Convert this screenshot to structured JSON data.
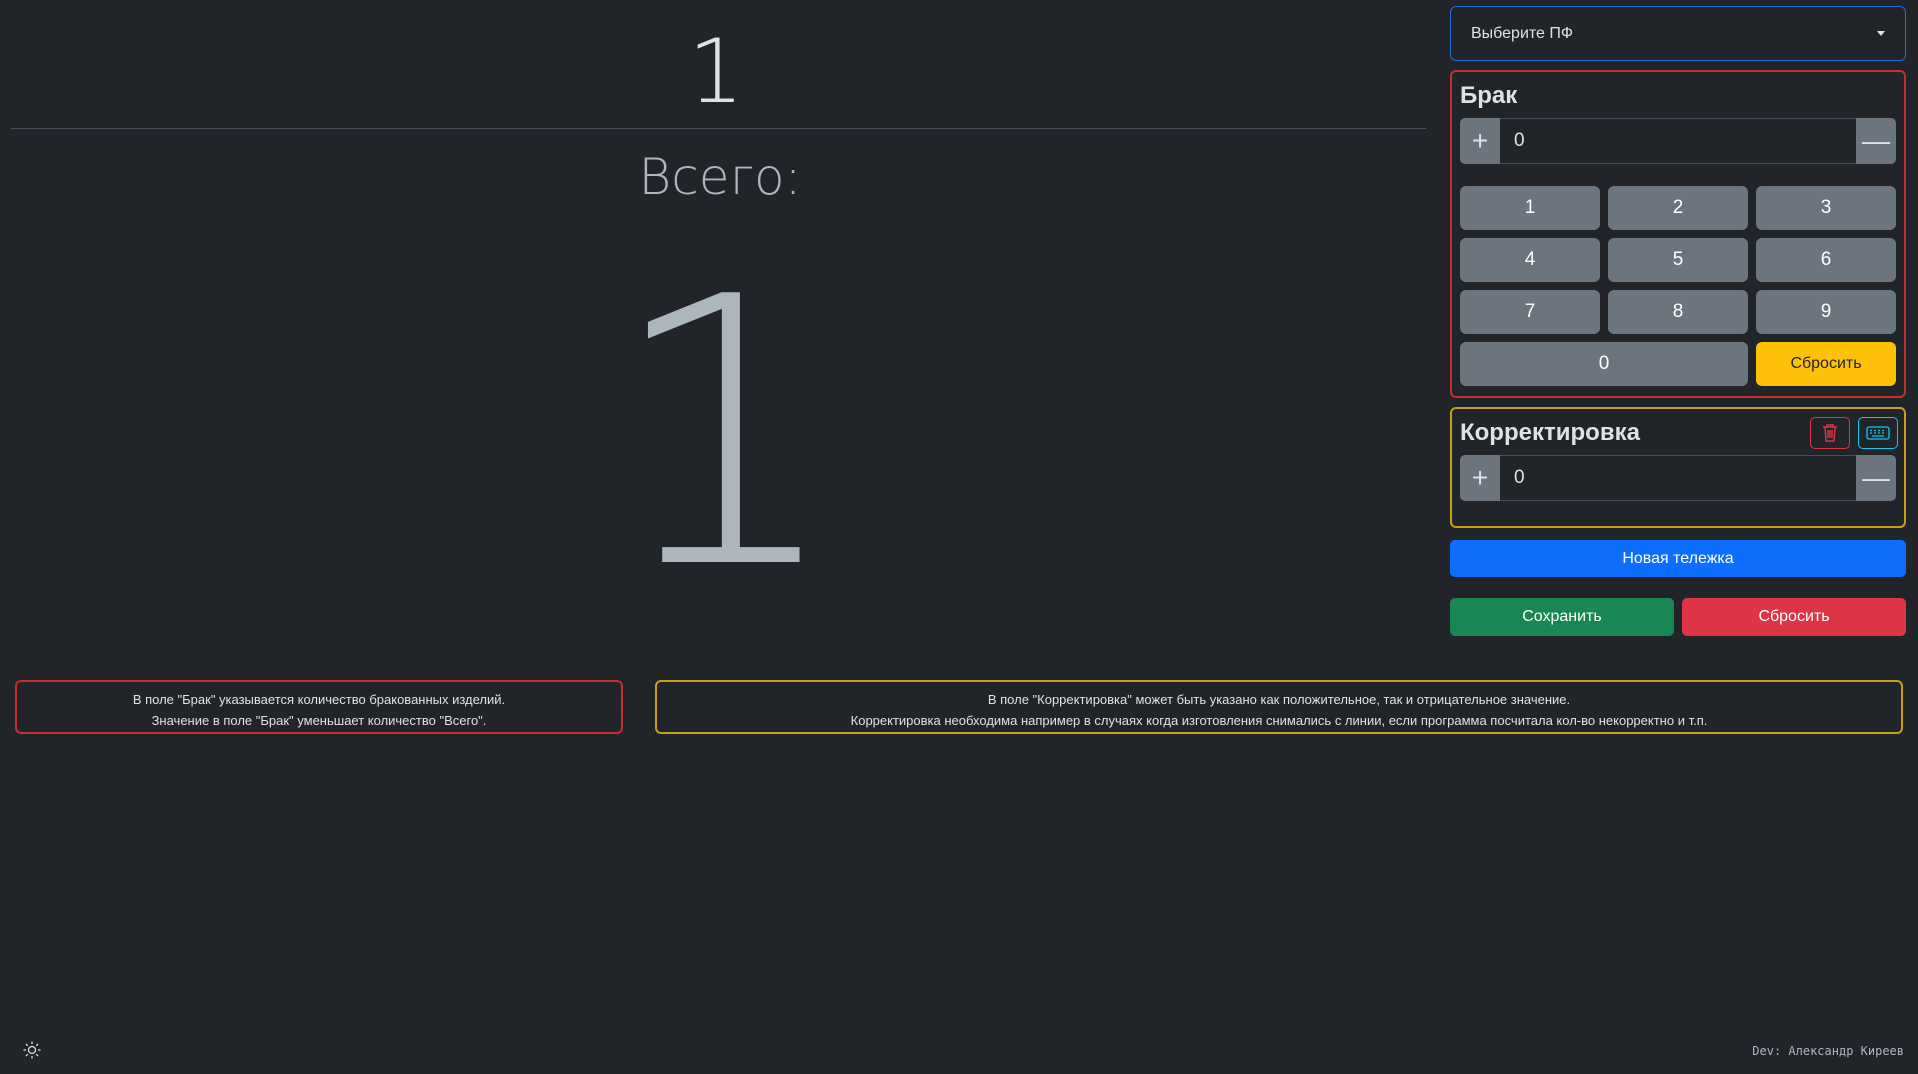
{
  "counter": {
    "top_value": "1",
    "total_label": "Всего:",
    "big_value": "1"
  },
  "select": {
    "label": "Выберите ПФ"
  },
  "brak": {
    "title": "Брак",
    "value": "0",
    "keys": [
      "1",
      "2",
      "3",
      "4",
      "5",
      "6",
      "7",
      "8",
      "9"
    ],
    "zero": "0",
    "reset_label": "Сбросить"
  },
  "korr": {
    "title": "Корректировка",
    "value": "0"
  },
  "buttons": {
    "new_cart": "Новая тележка",
    "save": "Сохранить",
    "reset": "Сбросить"
  },
  "info": {
    "brak_line1": "В поле \"Брак\" указывается количество бракованных изделий.",
    "brak_line2": "Значение в поле \"Брак\" уменьшает количество \"Всего\".",
    "korr_line1": "В поле \"Корректировка\" может быть указано как положительное, так и отрицательное значение.",
    "korr_line2": "Корректировка необходима например в случаях когда изготовления снимались с линии, если программа посчитала кол-во некорректно и т.п."
  },
  "footer": {
    "dev": "Dev: Александр Киреев"
  },
  "colors": {
    "background": "#212529",
    "primary": "#0d6efd",
    "success": "#198754",
    "danger": "#dc3545",
    "warning": "#ffc107",
    "info": "#0dcaf0"
  },
  "icons": [
    "chevron-down-icon",
    "plus-icon",
    "minus-icon",
    "trash-icon",
    "keyboard-icon",
    "sun-icon"
  ]
}
